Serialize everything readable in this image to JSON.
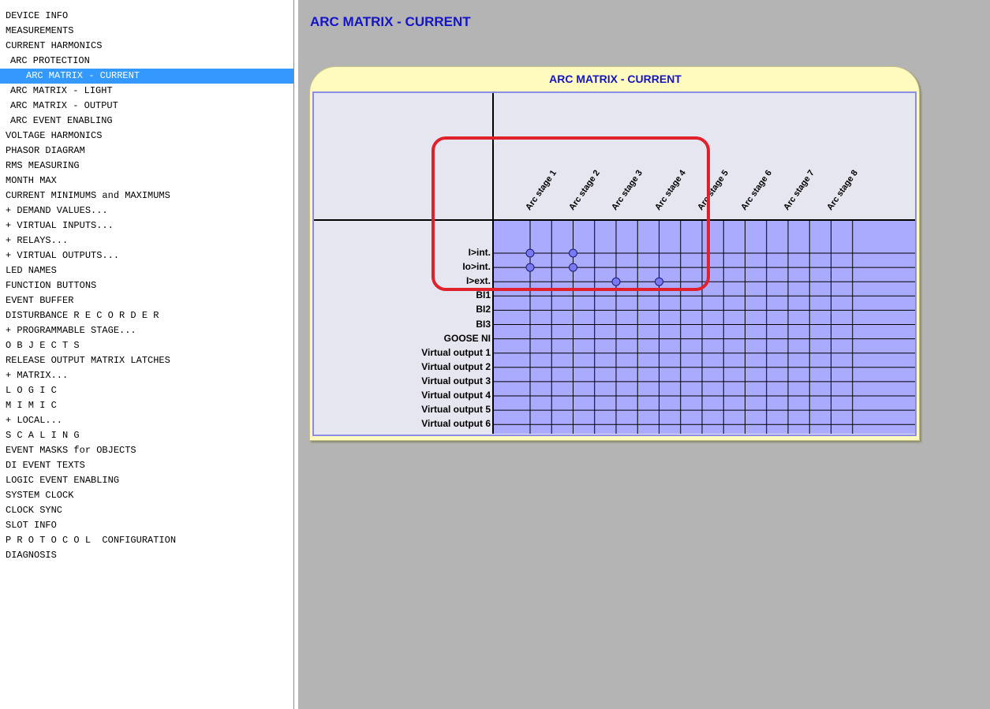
{
  "sidebar": {
    "items": [
      {
        "label": "DEVICE INFO",
        "indent": 0
      },
      {
        "label": "MEASUREMENTS",
        "indent": 0
      },
      {
        "label": "CURRENT HARMONICS",
        "indent": 0
      },
      {
        "label": "ARC PROTECTION",
        "indent": 1
      },
      {
        "label": "ARC MATRIX - CURRENT",
        "indent": 1,
        "selected": true
      },
      {
        "label": "ARC MATRIX - LIGHT",
        "indent": 1
      },
      {
        "label": "ARC MATRIX - OUTPUT",
        "indent": 1
      },
      {
        "label": "ARC EVENT ENABLING",
        "indent": 1
      },
      {
        "label": "VOLTAGE HARMONICS",
        "indent": 0
      },
      {
        "label": "PHASOR DIAGRAM",
        "indent": 0
      },
      {
        "label": "RMS MEASURING",
        "indent": 0
      },
      {
        "label": "MONTH MAX",
        "indent": 0
      },
      {
        "label": "CURRENT MINIMUMS and MAXIMUMS",
        "indent": 0
      },
      {
        "label": "+ DEMAND VALUES...",
        "indent": 0
      },
      {
        "label": "+ VIRTUAL INPUTS...",
        "indent": 0
      },
      {
        "label": "+ RELAYS...",
        "indent": 0
      },
      {
        "label": "+ VIRTUAL OUTPUTS...",
        "indent": 0
      },
      {
        "label": "LED NAMES",
        "indent": 0
      },
      {
        "label": "FUNCTION BUTTONS",
        "indent": 0
      },
      {
        "label": "EVENT BUFFER",
        "indent": 0
      },
      {
        "label": "DISTURBANCE R E C O R D E R",
        "indent": 0
      },
      {
        "label": "+ PROGRAMMABLE STAGE...",
        "indent": 0
      },
      {
        "label": "O B J E C T S",
        "indent": 0
      },
      {
        "label": "RELEASE OUTPUT MATRIX LATCHES",
        "indent": 0
      },
      {
        "label": "+ MATRIX...",
        "indent": 0
      },
      {
        "label": "L O G I C",
        "indent": 0
      },
      {
        "label": "M I M I C",
        "indent": 0
      },
      {
        "label": "+ LOCAL...",
        "indent": 0
      },
      {
        "label": "S C A L I N G",
        "indent": 0
      },
      {
        "label": "EVENT MASKS for OBJECTS",
        "indent": 0
      },
      {
        "label": "DI EVENT TEXTS",
        "indent": 0
      },
      {
        "label": "LOGIC EVENT ENABLING",
        "indent": 0
      },
      {
        "label": "SYSTEM CLOCK",
        "indent": 0
      },
      {
        "label": "CLOCK SYNC",
        "indent": 0
      },
      {
        "label": "SLOT INFO",
        "indent": 0
      },
      {
        "label": "P R O T O C O L  CONFIGURATION",
        "indent": 0
      },
      {
        "label": "DIAGNOSIS",
        "indent": 0
      }
    ]
  },
  "main": {
    "title": "ARC MATRIX - CURRENT",
    "panel_title": "ARC MATRIX - CURRENT"
  },
  "matrix": {
    "columns": [
      "Arc stage 1",
      "Arc stage 2",
      "Arc stage 3",
      "Arc stage 4",
      "Arc stage 5",
      "Arc stage 6",
      "Arc stage 7",
      "Arc stage 8"
    ],
    "rows": [
      "I>int.",
      "Io>int.",
      "I>ext.",
      "BI1",
      "BI2",
      "BI3",
      "GOOSE NI",
      "Virtual output 1",
      "Virtual output 2",
      "Virtual output 3",
      "Virtual output 4",
      "Virtual output 5",
      "Virtual output 6"
    ],
    "connections": [
      {
        "row": 0,
        "col": 0
      },
      {
        "row": 0,
        "col": 1
      },
      {
        "row": 1,
        "col": 0
      },
      {
        "row": 1,
        "col": 1
      },
      {
        "row": 2,
        "col": 2
      },
      {
        "row": 2,
        "col": 3
      }
    ]
  },
  "colors": {
    "title_blue": "#1414c8",
    "grid_fill": "#aaaaff",
    "panel_yellow": "#fffbbe",
    "selection_blue": "#3399ff",
    "highlight_red": "#e0202a",
    "background_gray": "#b4b4b4"
  }
}
